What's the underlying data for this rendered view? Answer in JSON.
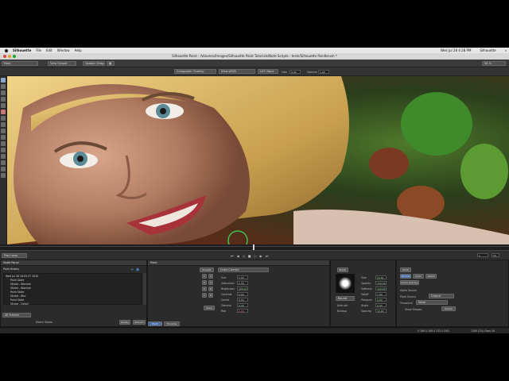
{
  "menubar": {
    "app": "Silhouette",
    "items": [
      "File",
      "Edit",
      "Window",
      "Help"
    ],
    "clock": "Wed Jul 28 4:28 PM",
    "user": "Silhouette"
  },
  "window": {
    "title": "Silhouette Paint - /Volumes/Images/Silhouette Paint Tutorials/Note Scripts - tests/Silhouette Paintbrush *"
  },
  "toolbar": {
    "mode": "Paint",
    "view": "View Output",
    "update": "Update: Drag",
    "comp": "Composite: Overlay",
    "colorspace": "View sRGB",
    "lut": "LUT: None",
    "gain_label": "Gain",
    "gain_value": "0.00",
    "gamma_label": "Gamma",
    "gamma_value": "1.00",
    "zoom": "58 %"
  },
  "transport": {
    "play_mode": "Play Loop",
    "frame": "1",
    "fps": "24"
  },
  "history_panel": {
    "title": "Node Panel",
    "subtitle": "Paint History",
    "items": [
      "Wed Jul 28 16:05:27 2020",
      "Paint State",
      "Stroke - Blemish",
      "Stroke - Blemish",
      "Paint State",
      "Stroke - Blur",
      "Paint State",
      "Stroke - Detail"
    ],
    "filter": "All Frames",
    "match_strokes": "Match Stroke",
    "replay": "Replay",
    "rebuild": "Rebuild"
  },
  "paint_panel": {
    "title": "Paint",
    "presets": "Presets",
    "color_correct": "Color Correct",
    "save": "Save",
    "params": [
      {
        "label": "Hue",
        "value": "0.00"
      },
      {
        "label": "Saturation",
        "value": "0.00"
      },
      {
        "label": "Brightness",
        "value": "100.00"
      },
      {
        "label": "Contrast",
        "value": "0.00"
      },
      {
        "label": "Center",
        "value": "0.00"
      },
      {
        "label": "Gamma",
        "value": "0.00"
      },
      {
        "label": "Red",
        "value": "0.00"
      }
    ],
    "tabs": [
      "Paint",
      "Timeline"
    ]
  },
  "brush_panel": {
    "title": "Brush",
    "shape": "Round",
    "airbrush": "Airbrush",
    "buildup": "Buildup",
    "params": [
      {
        "label": "Size",
        "value": "10.61"
      },
      {
        "label": "Opacity",
        "value": "100.00"
      },
      {
        "label": "Softness",
        "value": "100.00"
      },
      {
        "label": "Falloff",
        "value": "1.00"
      },
      {
        "label": "Pressure",
        "value": "0.00"
      },
      {
        "label": "Angle",
        "value": "0.00"
      },
      {
        "label": "Spacing",
        "value": "10.00"
      }
    ]
  },
  "source_panel": {
    "title": "Paint",
    "mode_buttons": [
      "Normal",
      "Color",
      "Detail"
    ],
    "clone_overlay": "Clone Overlay",
    "alpha_source": "Alpha Source",
    "paint_source_label": "Paint Source",
    "paint_source": "Output",
    "transform_label": "Transform",
    "transform": "None",
    "show_shapes": "Show Shapes",
    "delete": "Delete"
  },
  "statusbar": {
    "coords": "0.186 0.189 0.132 0.000",
    "info": "1280 (2%) float 16"
  },
  "colors": {
    "accent": "#4a6fa8",
    "panel": "#2b2b2b"
  }
}
